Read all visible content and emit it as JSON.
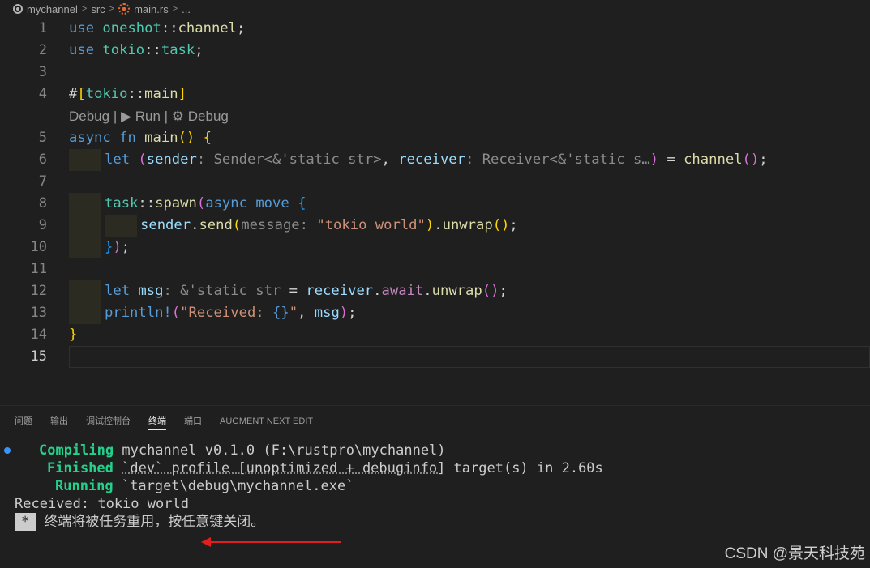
{
  "breadcrumb": {
    "items": [
      "mychannel",
      "src",
      "main.rs",
      "..."
    ],
    "icons": [
      "circle-dot-icon",
      "rust-file-icon"
    ]
  },
  "editor": {
    "lens": "Debug | ▶ Run | ⚙ Debug",
    "lines": [
      {
        "n": "1",
        "tokens": [
          [
            "kw",
            "use"
          ],
          [
            "pl",
            " "
          ],
          [
            "ns",
            "oneshot"
          ],
          [
            "pl",
            "::"
          ],
          [
            "fn",
            "channel"
          ],
          [
            "pl",
            ";"
          ]
        ]
      },
      {
        "n": "2",
        "tokens": [
          [
            "kw",
            "use"
          ],
          [
            "pl",
            " "
          ],
          [
            "ns",
            "tokio"
          ],
          [
            "pl",
            "::"
          ],
          [
            "ns",
            "task"
          ],
          [
            "pl",
            ";"
          ]
        ]
      },
      {
        "n": "3",
        "tokens": []
      },
      {
        "n": "4",
        "tokens": [
          [
            "pl",
            "#"
          ],
          [
            "b1",
            "["
          ],
          [
            "ns",
            "tokio"
          ],
          [
            "pl",
            "::"
          ],
          [
            "fn",
            "main"
          ],
          [
            "b1",
            "]"
          ]
        ]
      },
      {
        "n": "5",
        "tokens": [
          [
            "kw",
            "async"
          ],
          [
            "pl",
            " "
          ],
          [
            "kw",
            "fn"
          ],
          [
            "pl",
            " "
          ],
          [
            "fn",
            "main"
          ],
          [
            "b1",
            "()"
          ],
          [
            "pl",
            " "
          ],
          [
            "b1",
            "{"
          ]
        ]
      },
      {
        "n": "6",
        "tokens": [
          [
            "kw",
            "let"
          ],
          [
            "pl",
            " "
          ],
          [
            "b2",
            "("
          ],
          [
            "var",
            "sender"
          ],
          [
            "hint",
            ": Sender<&'static str>"
          ],
          [
            "pl",
            ", "
          ],
          [
            "var",
            "receiver"
          ],
          [
            "hint",
            ": Receiver<&'static s…"
          ],
          [
            "b2",
            ")"
          ],
          [
            "pl",
            " = "
          ],
          [
            "fn",
            "channel"
          ],
          [
            "b2",
            "()"
          ],
          [
            "pl",
            ";"
          ]
        ]
      },
      {
        "n": "7",
        "tokens": []
      },
      {
        "n": "8",
        "tokens": [
          [
            "ns",
            "task"
          ],
          [
            "pl",
            "::"
          ],
          [
            "fn",
            "spawn"
          ],
          [
            "b2",
            "("
          ],
          [
            "kw",
            "async"
          ],
          [
            "pl",
            " "
          ],
          [
            "kw",
            "move"
          ],
          [
            "pl",
            " "
          ],
          [
            "b3",
            "{"
          ]
        ]
      },
      {
        "n": "9",
        "tokens": [
          [
            "var",
            "sender"
          ],
          [
            "pl",
            "."
          ],
          [
            "fn",
            "send"
          ],
          [
            "b1",
            "("
          ],
          [
            "hint",
            "message: "
          ],
          [
            "str",
            "\"tokio world\""
          ],
          [
            "b1",
            ")"
          ],
          [
            "pl",
            "."
          ],
          [
            "fn",
            "unwrap"
          ],
          [
            "b1",
            "()"
          ],
          [
            "pl",
            ";"
          ]
        ]
      },
      {
        "n": "10",
        "tokens": [
          [
            "b3",
            "}"
          ],
          [
            "b2",
            ")"
          ],
          [
            "pl",
            ";"
          ]
        ]
      },
      {
        "n": "11",
        "tokens": []
      },
      {
        "n": "12",
        "tokens": [
          [
            "kw",
            "let"
          ],
          [
            "pl",
            " "
          ],
          [
            "var",
            "msg"
          ],
          [
            "hint",
            ": &'static str"
          ],
          [
            "pl",
            " = "
          ],
          [
            "var",
            "receiver"
          ],
          [
            "pl",
            "."
          ],
          [
            "ctrl",
            "await"
          ],
          [
            "pl",
            "."
          ],
          [
            "fn",
            "unwrap"
          ],
          [
            "b2",
            "()"
          ],
          [
            "pl",
            ";"
          ]
        ]
      },
      {
        "n": "13",
        "tokens": [
          [
            "mac",
            "println!"
          ],
          [
            "b2",
            "("
          ],
          [
            "str",
            "\"Received: "
          ],
          [
            "kw",
            "{}"
          ],
          [
            "str",
            "\""
          ],
          [
            "pl",
            ", "
          ],
          [
            "var",
            "msg"
          ],
          [
            "b2",
            ")"
          ],
          [
            "pl",
            ";"
          ]
        ]
      },
      {
        "n": "14",
        "tokens": [
          [
            "b1",
            "}"
          ]
        ]
      },
      {
        "n": "15",
        "tokens": []
      }
    ]
  },
  "panel": {
    "tabs": [
      "问题",
      "输出",
      "调试控制台",
      "终端",
      "端口",
      "AUGMENT NEXT EDIT"
    ],
    "active_tab": "终端",
    "terminal": {
      "compiling_label": "Compiling",
      "compiling_text": " mychannel v0.1.0 (F:\\rustpro\\mychannel)",
      "finished_label": "Finished",
      "finished_pre": " ",
      "finished_ul": "`dev` profile [unoptimized + debuginfo]",
      "finished_post": " target(s) in 2.60s",
      "running_label": "Running",
      "running_text": " `target\\debug\\mychannel.exe`",
      "output": "Received: tokio world",
      "star": "*",
      "close_msg": "终端将被任务重用，按任意键关闭。"
    }
  },
  "watermark": "CSDN @景天科技苑",
  "colors": {
    "accent_red": "#e02020",
    "green": "#23d18b",
    "blue_dot": "#3794ff"
  }
}
